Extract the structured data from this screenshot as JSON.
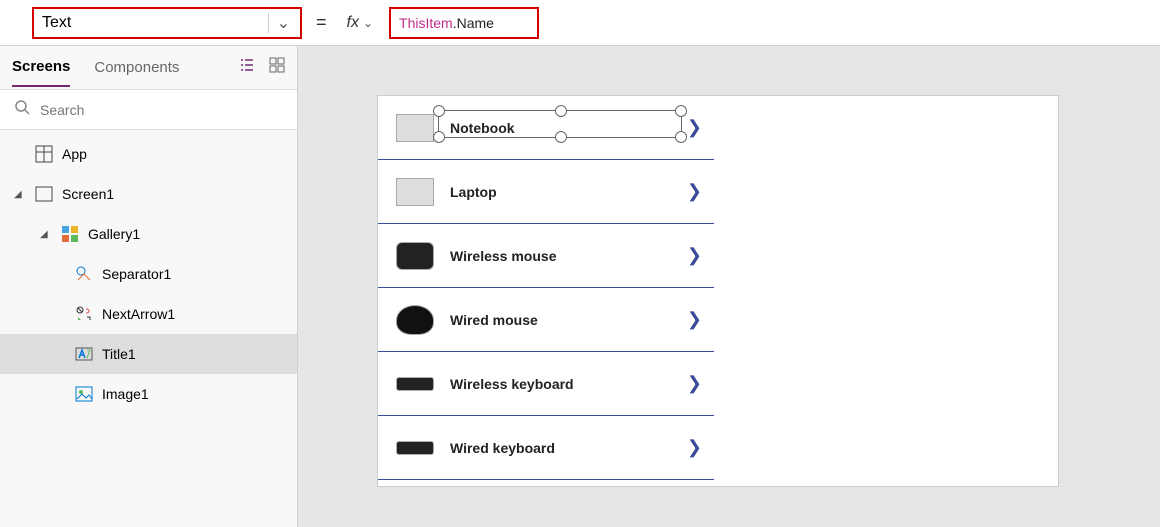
{
  "formula_bar": {
    "property": "Text",
    "equals": "=",
    "fx": "fx",
    "formula_this": "ThisItem",
    "formula_rest": ".Name"
  },
  "left_panel": {
    "tabs": {
      "screens": "Screens",
      "components": "Components"
    },
    "search_placeholder": "Search",
    "tree": {
      "app": "App",
      "screen1": "Screen1",
      "gallery1": "Gallery1",
      "separator1": "Separator1",
      "nextarrow1": "NextArrow1",
      "title1": "Title1",
      "image1": "Image1"
    }
  },
  "gallery": {
    "items": [
      {
        "label": "Notebook"
      },
      {
        "label": "Laptop"
      },
      {
        "label": "Wireless mouse"
      },
      {
        "label": "Wired mouse"
      },
      {
        "label": "Wireless keyboard"
      },
      {
        "label": "Wired keyboard"
      }
    ]
  }
}
